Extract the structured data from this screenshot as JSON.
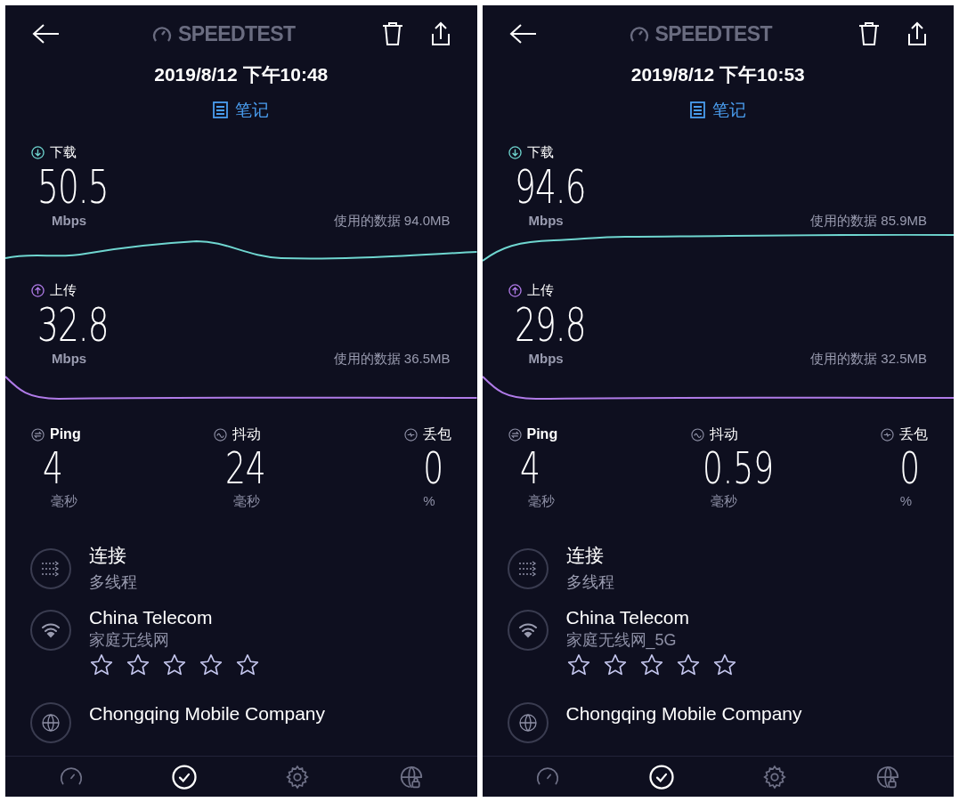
{
  "panels": [
    {
      "logo": "SPEEDTEST",
      "timestamp": "2019/8/12 下午10:48",
      "notes_link": "笔记",
      "download": {
        "label": "下载",
        "value": "50.5",
        "unit": "Mbps",
        "data_used": "使用的数据 94.0MB"
      },
      "upload": {
        "label": "上传",
        "value": "32.8",
        "unit": "Mbps",
        "data_used": "使用的数据 36.5MB"
      },
      "metrics": [
        {
          "kind": "ping",
          "label": "Ping",
          "value": "4",
          "unit": "毫秒"
        },
        {
          "kind": "jitter",
          "label": "抖动",
          "value": "24",
          "unit": "毫秒"
        },
        {
          "kind": "loss",
          "label": "丢包",
          "value": "0",
          "unit": "%"
        }
      ],
      "connection": {
        "title": "连接",
        "value": "多线程"
      },
      "network": {
        "name": "China Telecom",
        "ssid": "家庭无线网",
        "stars": 0
      },
      "server": {
        "name": "Chongqing Mobile Company"
      },
      "nav": [
        {
          "kind": "speed",
          "selected": false
        },
        {
          "kind": "results",
          "selected": true
        },
        {
          "kind": "settings",
          "selected": false
        },
        {
          "kind": "vpn",
          "selected": false
        }
      ]
    },
    {
      "logo": "SPEEDTEST",
      "timestamp": "2019/8/12 下午10:53",
      "notes_link": "笔记",
      "download": {
        "label": "下载",
        "value": "94.6",
        "unit": "Mbps",
        "data_used": "使用的数据 85.9MB"
      },
      "upload": {
        "label": "上传",
        "value": "29.8",
        "unit": "Mbps",
        "data_used": "使用的数据 32.5MB"
      },
      "metrics": [
        {
          "kind": "ping",
          "label": "Ping",
          "value": "4",
          "unit": "毫秒"
        },
        {
          "kind": "jitter",
          "label": "抖动",
          "value": "0.59",
          "unit": "毫秒"
        },
        {
          "kind": "loss",
          "label": "丢包",
          "value": "0",
          "unit": "%"
        }
      ],
      "connection": {
        "title": "连接",
        "value": "多线程"
      },
      "network": {
        "name": "China Telecom",
        "ssid": "家庭无线网_5G",
        "stars": 0
      },
      "server": {
        "name": "Chongqing Mobile Company"
      },
      "nav": [
        {
          "kind": "speed",
          "selected": false
        },
        {
          "kind": "results",
          "selected": true
        },
        {
          "kind": "settings",
          "selected": false
        },
        {
          "kind": "vpn",
          "selected": false
        }
      ]
    }
  ]
}
